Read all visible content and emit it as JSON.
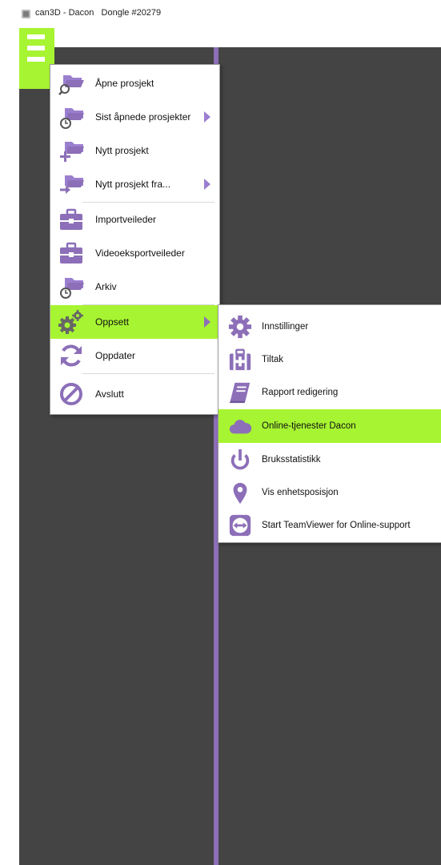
{
  "window": {
    "title": "can3D - Dacon   Dongle #20279"
  },
  "colors": {
    "accent_green": "#a7f432",
    "accent_purple": "#8c6fb8",
    "canvas_dark": "#444444"
  },
  "main_menu": {
    "items": [
      {
        "label": "Åpne prosjekt",
        "icon": "folder-search-icon"
      },
      {
        "label": "Sist åpnede prosjekter",
        "icon": "folder-clock-icon",
        "submenu": true
      },
      {
        "label": "Nytt prosjekt",
        "icon": "folder-add-icon"
      },
      {
        "label": "Nytt prosjekt fra...",
        "icon": "folder-arrow-icon",
        "submenu": true
      },
      {
        "label": "Importveileder",
        "icon": "briefcase-icon"
      },
      {
        "label": "Videoeksportveileder",
        "icon": "briefcase-icon"
      },
      {
        "label": "Arkiv",
        "icon": "folder-clock-icon"
      },
      {
        "label": "Oppsett",
        "icon": "gears-icon",
        "submenu": true,
        "highlighted": true
      },
      {
        "label": "Oppdater",
        "icon": "refresh-icon"
      },
      {
        "label": "Avslutt",
        "icon": "no-entry-icon"
      }
    ]
  },
  "settings_submenu": {
    "items": [
      {
        "label": "Innstillinger",
        "icon": "gear-icon"
      },
      {
        "label": "Tiltak",
        "icon": "first-aid-kit-icon"
      },
      {
        "label": "Rapport redigering",
        "icon": "book-icon"
      },
      {
        "label": "Online-tjenester Dacon",
        "icon": "cloud-icon",
        "highlighted": true
      },
      {
        "label": "Bruksstatistikk",
        "icon": "power-icon"
      },
      {
        "label": "Vis enhetsposisjon",
        "icon": "map-pin-icon"
      },
      {
        "label": "Start TeamViewer for Online-support",
        "icon": "teamviewer-icon"
      }
    ]
  }
}
